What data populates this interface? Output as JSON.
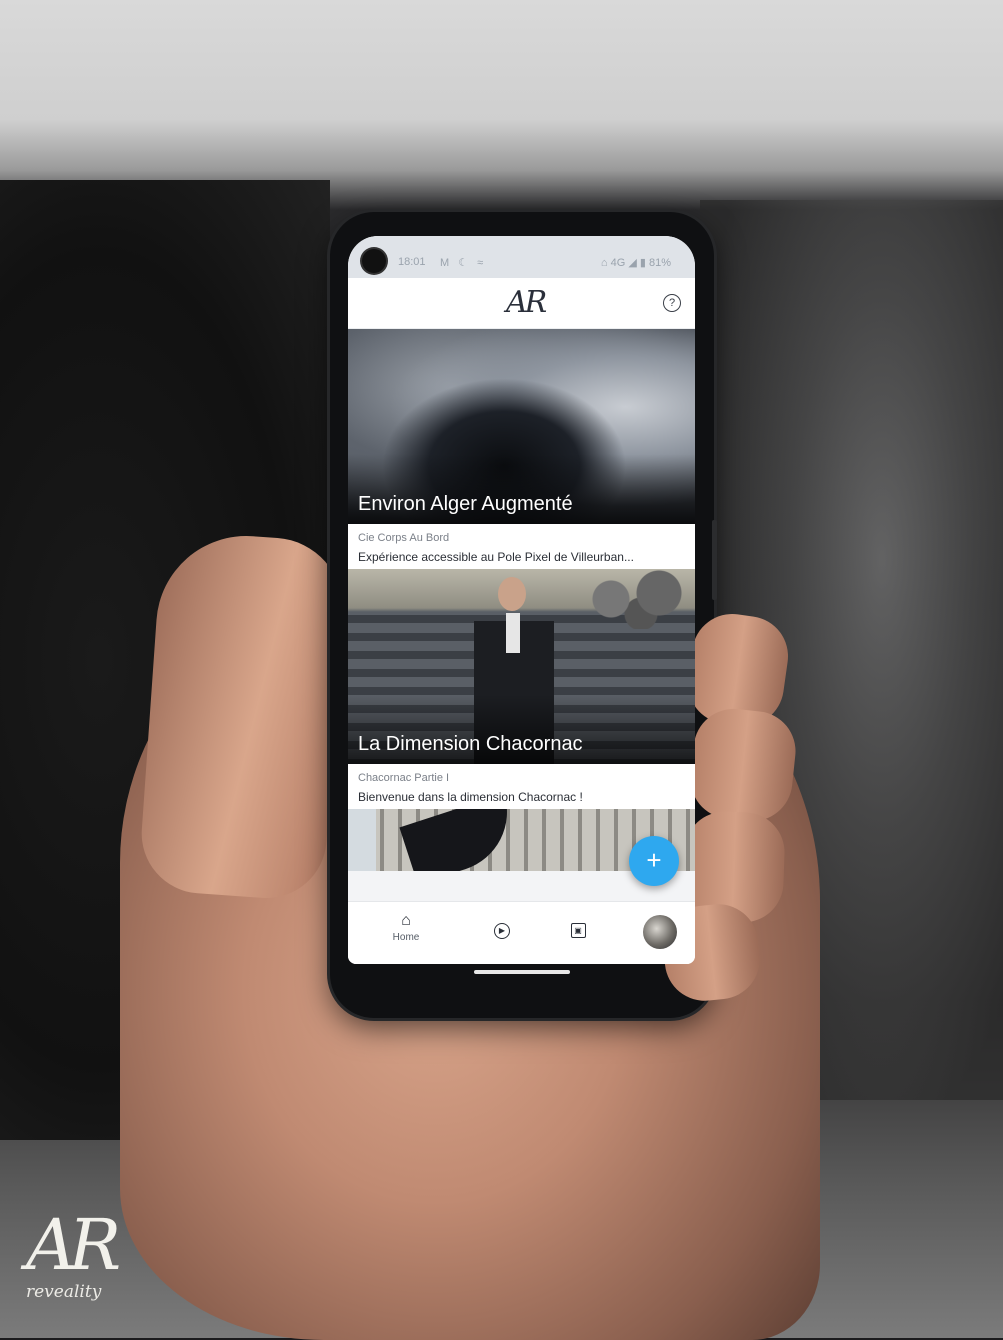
{
  "status_bar": {
    "time": "18:01",
    "left_icons": "M ☾ ≈",
    "right": "⌂ 4G ◢ ▮ 81%"
  },
  "app": {
    "logo": "AR",
    "help_label": "?"
  },
  "cards": [
    {
      "title": "Environ Alger Augmenté",
      "author": "Cie Corps Au Bord",
      "description": "Expérience accessible au Pole Pixel de Villeurban..."
    },
    {
      "title": "La Dimension Chacornac",
      "author": "Chacornac Partie I",
      "description": "Bienvenue dans la dimension Chacornac !"
    }
  ],
  "fab_label": "+",
  "bottom_nav": {
    "home_icon": "⌂",
    "home_label": "Home",
    "play_icon": "▶",
    "gallery_icon": "▣"
  },
  "watermark": {
    "mark": "AR",
    "name": "reveality"
  }
}
